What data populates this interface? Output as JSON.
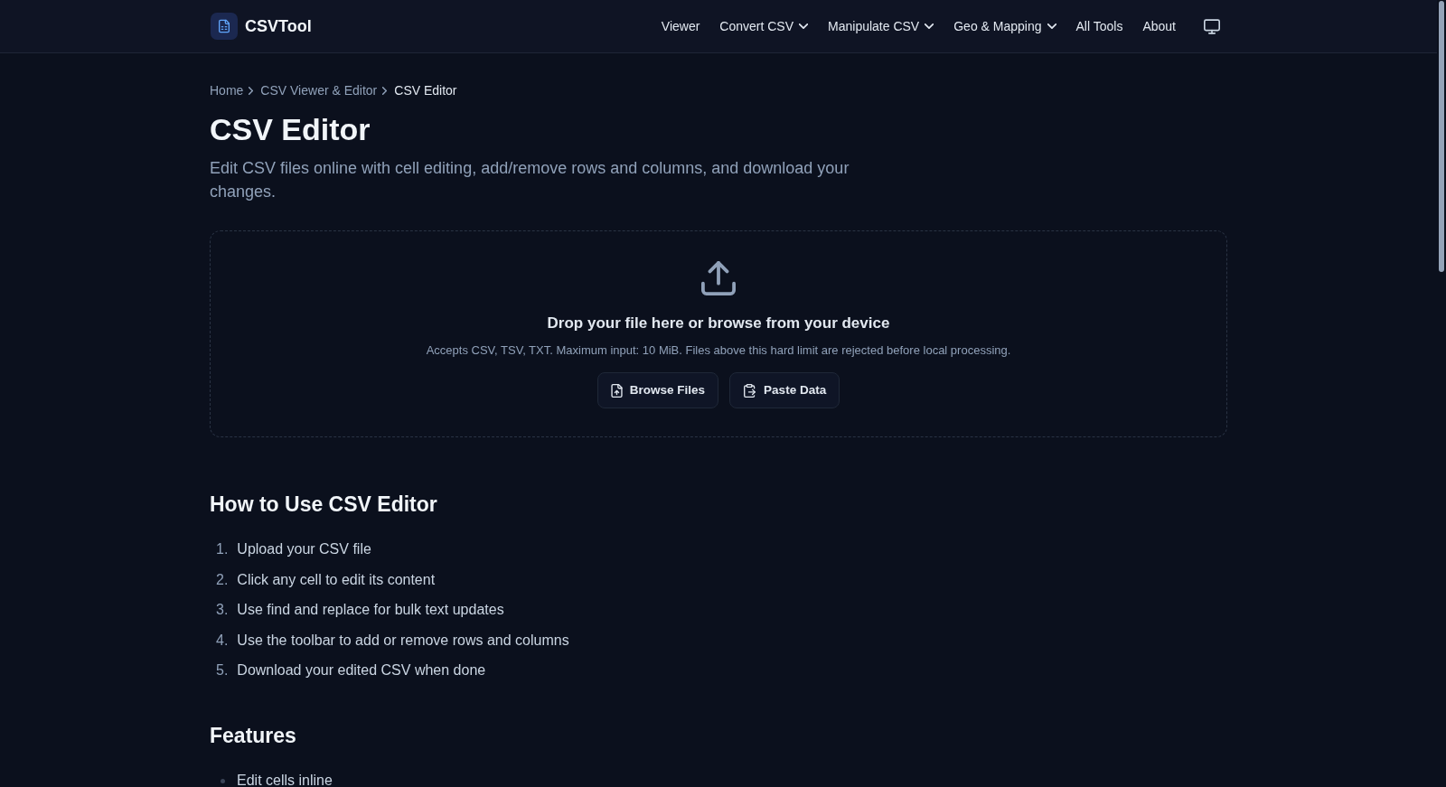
{
  "header": {
    "logo": {
      "text": "CSVTool"
    },
    "nav": [
      {
        "label": "Viewer",
        "dropdown": false
      },
      {
        "label": "Convert CSV",
        "dropdown": true
      },
      {
        "label": "Manipulate CSV",
        "dropdown": true
      },
      {
        "label": "Geo & Mapping",
        "dropdown": true
      },
      {
        "label": "All Tools",
        "dropdown": false
      },
      {
        "label": "About",
        "dropdown": false
      }
    ]
  },
  "breadcrumb": [
    {
      "label": "Home",
      "current": false
    },
    {
      "label": "CSV Viewer & Editor",
      "current": false
    },
    {
      "label": "CSV Editor",
      "current": true
    }
  ],
  "title": "CSV Editor",
  "description": "Edit CSV files online with cell editing, add/remove rows and columns, and download your changes.",
  "dropzone": {
    "heading": "Drop your file here or browse from your device",
    "note": "Accepts CSV, TSV, TXT. Maximum input: 10 MiB. Files above this hard limit are rejected before local processing.",
    "buttons": [
      {
        "label": "Browse Files",
        "kind": "browse"
      },
      {
        "label": "Paste Data",
        "kind": "paste"
      }
    ]
  },
  "sections": [
    {
      "heading": "How to Use CSV Editor",
      "kind": "ordered",
      "items": [
        {
          "marker": "1.",
          "text": "Upload your CSV file"
        },
        {
          "marker": "2.",
          "text": "Click any cell to edit its content"
        },
        {
          "marker": "3.",
          "text": "Use find and replace for bulk text updates"
        },
        {
          "marker": "4.",
          "text": "Use the toolbar to add or remove rows and columns"
        },
        {
          "marker": "5.",
          "text": "Download your edited CSV when done"
        }
      ]
    },
    {
      "heading": "Features",
      "kind": "bullet",
      "items": [
        {
          "text": "Edit cells inline"
        }
      ]
    }
  ]
}
